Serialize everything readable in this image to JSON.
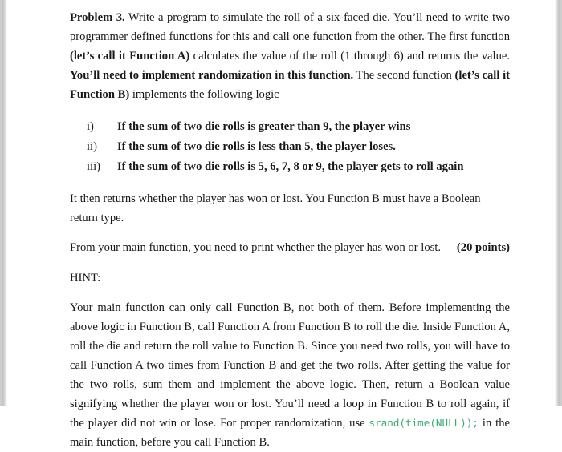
{
  "document": {
    "problem": {
      "heading_label": "Problem 3.",
      "intro_run_1": " Write a program to simulate the roll of a six-faced die. You’ll need to write two programmer defined functions for this and call one function from the other. The first function ",
      "intro_run_2_bold": "(let’s call it Function A)",
      "intro_run_3": " calculates the value of the roll (1 through 6) and returns the value. ",
      "intro_run_4_bold": "You’ll need to implement randomization in this function.",
      "intro_run_5": " The second function ",
      "intro_run_6_bold": "(let’s call it Function B)",
      "intro_run_7": " implements the following logic"
    },
    "logic_list": [
      {
        "marker": "i)",
        "text": "If the sum of two die rolls is greater than 9, the player wins"
      },
      {
        "marker": "ii)",
        "text": "If the sum of two die rolls is less than 5, the player loses."
      },
      {
        "marker": "iii)",
        "text": "If the sum of two die rolls is 5, 6, 7, 8 or 9, the player gets to roll again"
      }
    ],
    "after_list_paragraph": "It then returns whether the player has won or lost. You Function B must have a Boolean return type.",
    "points_line": {
      "text": "From your main function, you need to print whether the player has won or lost.",
      "points": "(20 points)"
    },
    "hint_label": "HINT:",
    "hint": {
      "run_1": "Your main function can only call Function B, not both of them. Before implementing the above logic in Function B, call Function A from Function B to roll the die. Inside Function A, roll the die and return the roll value to Function B. Since you need two rolls, you will have to call Function A two times from Function B and get the two rolls. After getting the value for the two rolls, sum them and implement the above logic. Then, return a Boolean value signifying whether the player won or lost. You’ll need a loop in Function B to roll again, if the player did not win or lose. For proper randomization, use ",
      "code": "srand(time(NULL));",
      "run_2": "  in the main function, before you call Function B."
    }
  },
  "colors": {
    "page_background": "#ffffff",
    "text": "#181818",
    "code_green": "#3cab78",
    "page_edge_gray": "#c4c4c4"
  }
}
